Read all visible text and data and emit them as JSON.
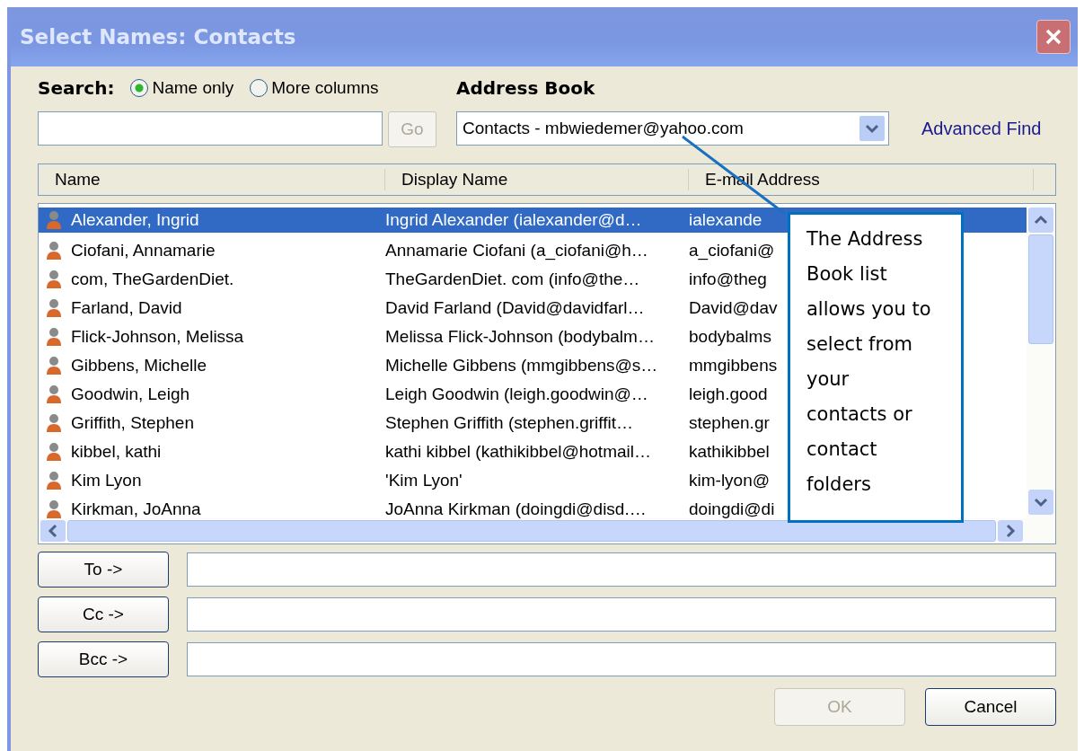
{
  "window": {
    "title": "Select Names: Contacts"
  },
  "search": {
    "label": "Search:",
    "options": [
      {
        "label": "Name only",
        "selected": true
      },
      {
        "label": "More columns",
        "selected": false
      }
    ],
    "go_button": {
      "label": "Go",
      "disabled": true
    }
  },
  "address_book": {
    "label": "Address Book",
    "value": "Contacts - mbwiedemer@yahoo.com",
    "advanced_find": "Advanced Find"
  },
  "table": {
    "columns": [
      "Name",
      "Display Name",
      "E-mail Address"
    ],
    "rows": [
      {
        "name": "Alexander, Ingrid",
        "display_name": "Ingrid Alexander (ialexander@d…",
        "email": "ialexande",
        "selected": true
      },
      {
        "name": "Ciofani, Annamarie",
        "display_name": "Annamarie Ciofani (a_ciofani@h…",
        "email": "a_ciofani@",
        "selected": false
      },
      {
        "name": "com, TheGardenDiet.",
        "display_name": "TheGardenDiet. com (info@the…",
        "email": "info@theg",
        "selected": false
      },
      {
        "name": "Farland, David",
        "display_name": "David Farland (David@davidfarl…",
        "email": "David@dav",
        "selected": false
      },
      {
        "name": "Flick-Johnson, Melissa",
        "display_name": "Melissa Flick-Johnson (bodybalm…",
        "email": "bodybalms",
        "selected": false
      },
      {
        "name": "Gibbens, Michelle",
        "display_name": "Michelle Gibbens (mmgibbens@s…",
        "email": "mmgibbens",
        "selected": false
      },
      {
        "name": "Goodwin, Leigh",
        "display_name": "Leigh Goodwin (leigh.goodwin@…",
        "email": "leigh.good",
        "selected": false
      },
      {
        "name": "Griffith, Stephen",
        "display_name": "Stephen Griffith (stephen.griffit…",
        "email": "stephen.gr",
        "selected": false
      },
      {
        "name": "kibbel, kathi",
        "display_name": "kathi kibbel (kathikibbel@hotmail…",
        "email": "kathikibbel",
        "selected": false
      },
      {
        "name": "Kim Lyon",
        "display_name": "'Kim Lyon'",
        "email": "kim-lyon@",
        "selected": false
      },
      {
        "name": "Kirkman, JoAnna",
        "display_name": "JoAnna Kirkman (doingdi@disd.…",
        "email": "doingdi@di",
        "selected": false
      }
    ]
  },
  "recipients": [
    {
      "button": "To ->"
    },
    {
      "button": "Cc ->"
    },
    {
      "button": "Bcc ->"
    }
  ],
  "buttons": [
    {
      "label": "OK",
      "disabled": true
    },
    {
      "label": "Cancel",
      "disabled": false
    }
  ],
  "callout": {
    "text": "The Address Book list allows you to select from your contacts or contact folders"
  }
}
